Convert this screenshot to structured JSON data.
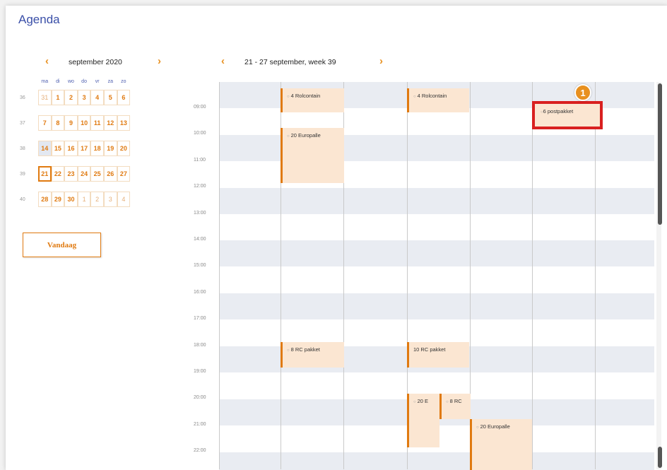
{
  "app": {
    "title": "Agenda"
  },
  "mini_calendar": {
    "month_label": "september 2020",
    "prev_icon": "chevron-left-icon",
    "next_icon": "chevron-right-icon",
    "weekday_headers": [
      "ma",
      "di",
      "wo",
      "do",
      "vr",
      "za",
      "zo"
    ],
    "weeks": [
      {
        "number": "36",
        "days": [
          "31",
          "1",
          "2",
          "3",
          "4",
          "5",
          "6"
        ]
      },
      {
        "number": "37",
        "days": [
          "7",
          "8",
          "9",
          "10",
          "11",
          "12",
          "13"
        ]
      },
      {
        "number": "38",
        "days": [
          "14",
          "15",
          "16",
          "17",
          "18",
          "19",
          "20"
        ]
      },
      {
        "number": "39",
        "days": [
          "21",
          "22",
          "23",
          "24",
          "25",
          "26",
          "27"
        ]
      },
      {
        "number": "40",
        "days": [
          "28",
          "29",
          "30",
          "1",
          "2",
          "3",
          "4"
        ]
      }
    ],
    "selected_day": "21",
    "today_button": "Vandaag"
  },
  "week_view": {
    "title": "21 - 27 september, week 39",
    "hours": [
      "09:00",
      "10:00",
      "11:00",
      "12:00",
      "13:00",
      "14:00",
      "15:00",
      "16:00",
      "17:00",
      "18:00",
      "19:00",
      "20:00",
      "21:00",
      "22:00"
    ],
    "events": [
      {
        "label": "4 Rolcontain"
      },
      {
        "label": "20 Europalle"
      },
      {
        "label": "4 Rolcontain"
      },
      {
        "label": "6 postpakket"
      },
      {
        "label": "8 RC pakket"
      },
      {
        "label": "10 RC pakket"
      },
      {
        "label": "20 E"
      },
      {
        "label": "8 RC"
      },
      {
        "label": "20 Europalle"
      }
    ]
  },
  "annotation": {
    "badge": "1"
  },
  "colors": {
    "accent": "#e07a10",
    "title": "#3a4fa8",
    "event_bg": "#fbe6d2",
    "highlight": "#d92020"
  }
}
